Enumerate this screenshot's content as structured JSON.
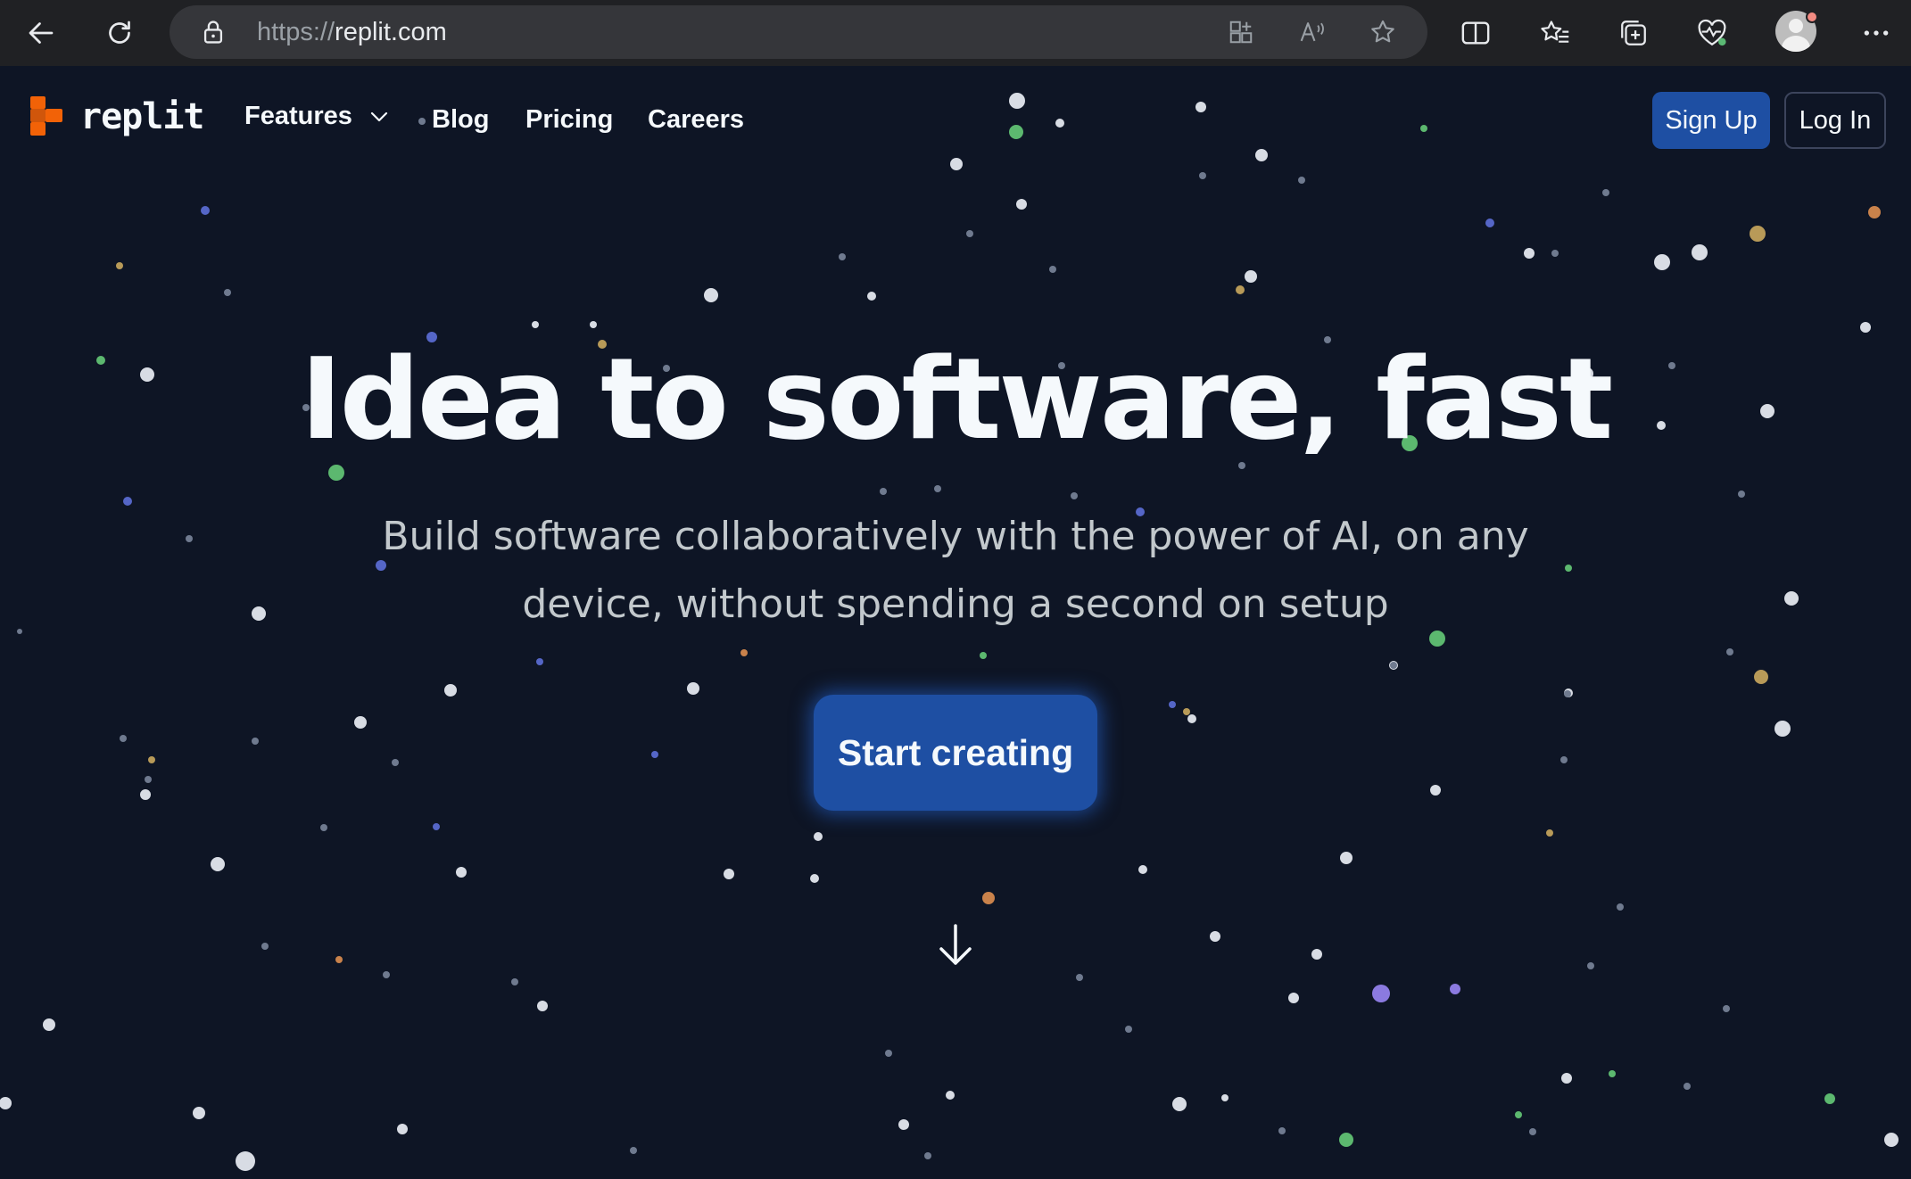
{
  "browser": {
    "url_protocol": "https://",
    "url_host": "replit.com",
    "icons": [
      "back-icon",
      "refresh-icon",
      "lock-icon",
      "app-available-icon",
      "read-aloud-icon",
      "favorite-star-icon",
      "split-screen-icon",
      "favorites-icon",
      "collections-icon",
      "browser-essentials-icon",
      "profile-avatar-icon",
      "more-menu-icon"
    ]
  },
  "header": {
    "brand": "replit",
    "nav": {
      "features": "Features",
      "blog": "Blog",
      "pricing": "Pricing",
      "careers": "Careers"
    },
    "signup": "Sign Up",
    "login": "Log In"
  },
  "hero": {
    "title": "Idea to software, fast",
    "subtitle_line1": "Build software collaboratively with the power of AI, on any",
    "subtitle_line2": "device, without spending a second on setup",
    "cta": "Start creating"
  },
  "colors": {
    "background": "#0e1525",
    "primary": "#1e4fa3",
    "brand_orange": "#f26207",
    "text": "#f5f9fc",
    "subtext": "#c2c8cc"
  }
}
